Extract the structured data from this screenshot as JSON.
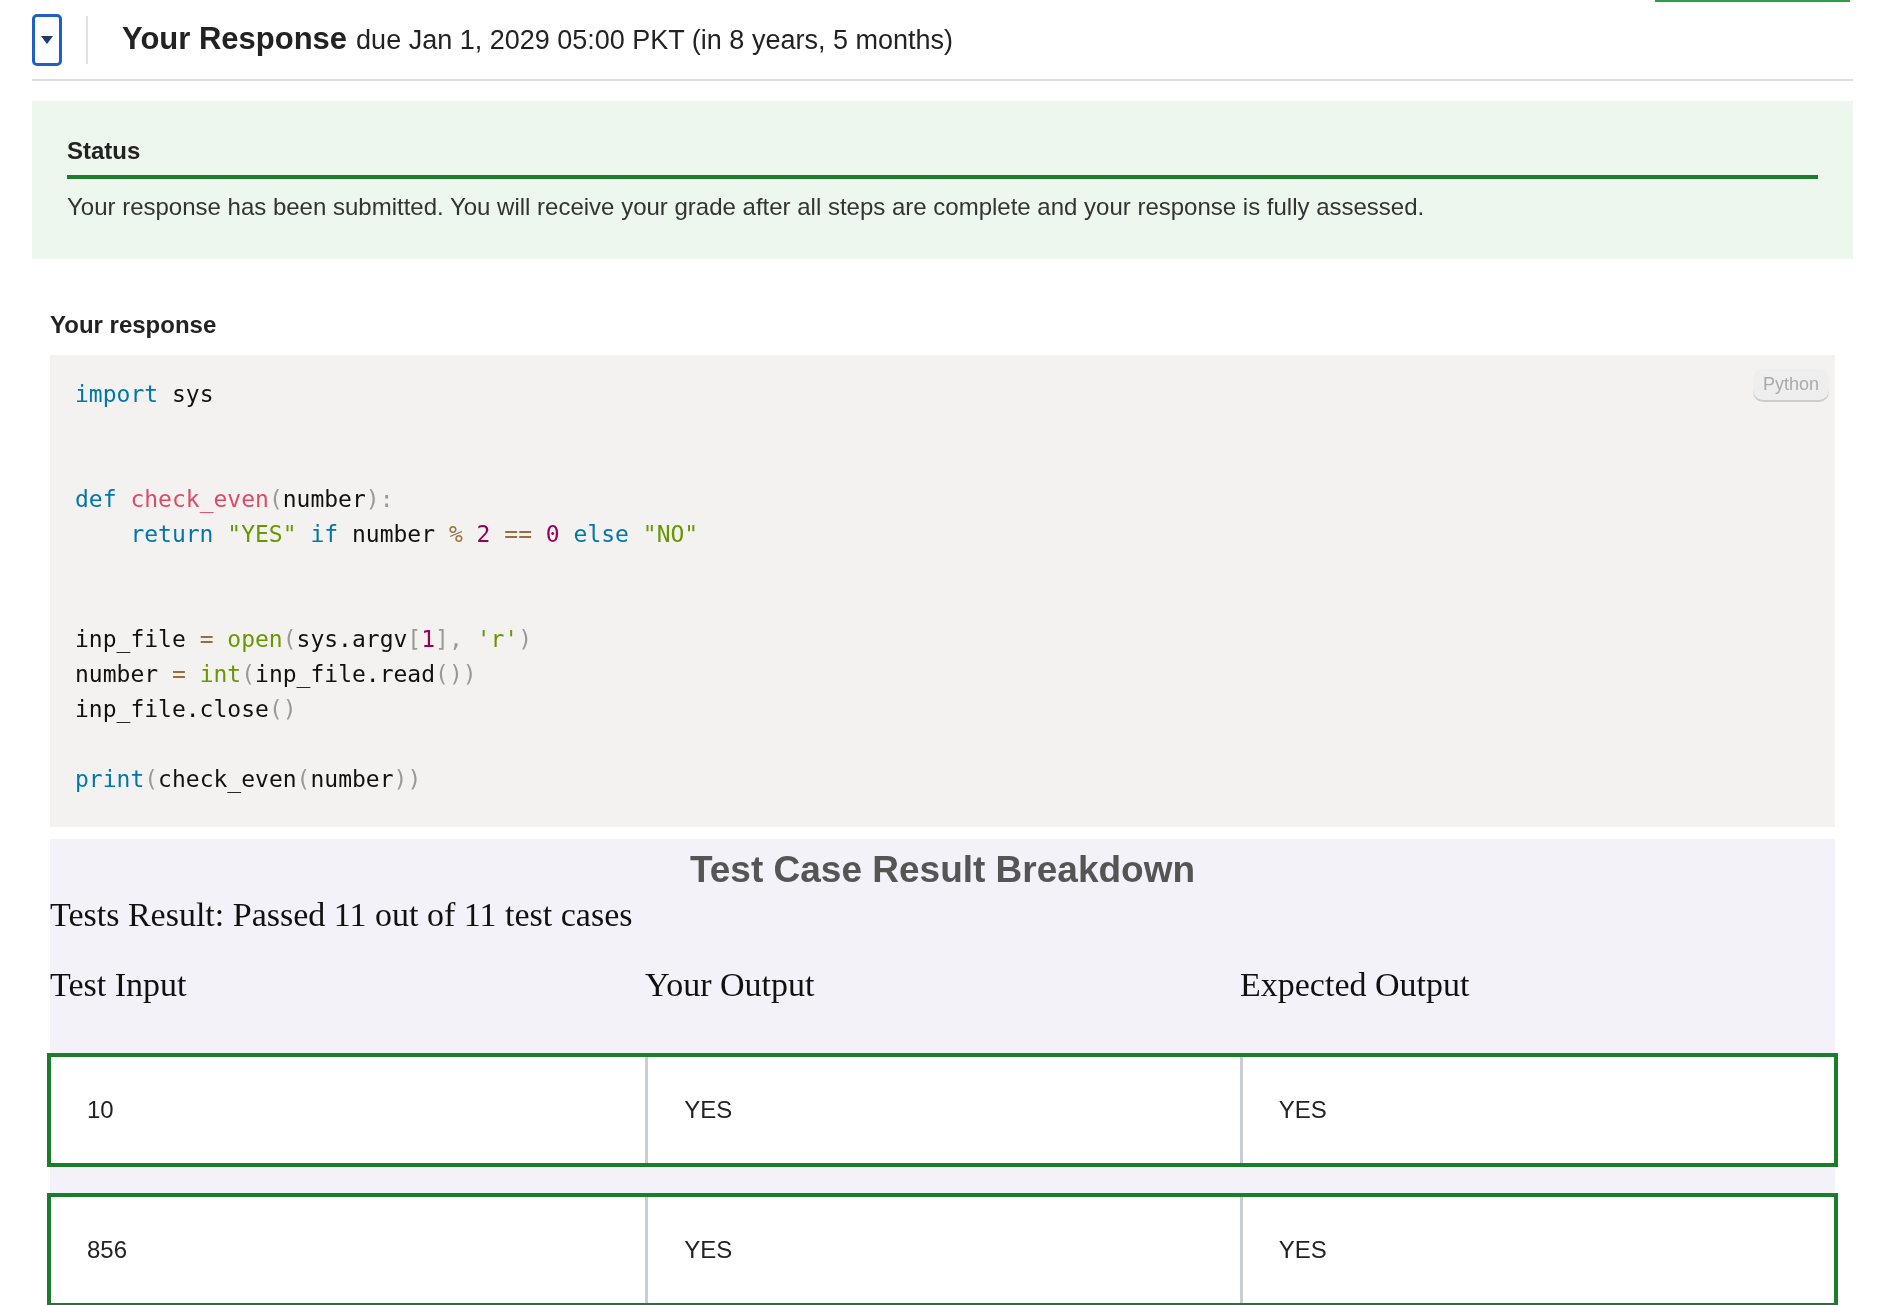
{
  "header": {
    "title": "Your Response",
    "due": "due Jan 1, 2029 05:00 PKT (in 8 years, 5 months)",
    "expanded": true
  },
  "status": {
    "heading": "Status",
    "message": "Your response has been submitted. You will receive your grade after all steps are complete and your response is fully assessed."
  },
  "response": {
    "label": "Your response",
    "language": "Python",
    "code_lines": [
      {
        "kind": "code",
        "tokens": [
          {
            "kind": "keyword",
            "text": "import"
          },
          {
            "kind": "plain",
            "text": " sys"
          }
        ]
      },
      {
        "kind": "blank"
      },
      {
        "kind": "blank"
      },
      {
        "kind": "code",
        "tokens": [
          {
            "kind": "keyword",
            "text": "def "
          },
          {
            "kind": "function",
            "text": "check_even"
          },
          {
            "kind": "punct",
            "text": "("
          },
          {
            "kind": "plain",
            "text": "number"
          },
          {
            "kind": "punct",
            "text": "):"
          }
        ]
      },
      {
        "kind": "code",
        "tokens": [
          {
            "kind": "keyword",
            "text": "    return "
          },
          {
            "kind": "string",
            "text": "\"YES\" "
          },
          {
            "kind": "keyword",
            "text": "if"
          },
          {
            "kind": "plain",
            "text": " number "
          },
          {
            "kind": "operator",
            "text": "%"
          },
          {
            "kind": "number",
            "text": " 2 "
          },
          {
            "kind": "operator",
            "text": "=="
          },
          {
            "kind": "number",
            "text": " 0 "
          },
          {
            "kind": "keyword",
            "text": "else "
          },
          {
            "kind": "string",
            "text": "\"NO\""
          }
        ]
      },
      {
        "kind": "blank"
      },
      {
        "kind": "blank"
      },
      {
        "kind": "code",
        "tokens": [
          {
            "kind": "plain",
            "text": "inp_file "
          },
          {
            "kind": "operator",
            "text": "= "
          },
          {
            "kind": "builtin",
            "text": "open"
          },
          {
            "kind": "punct",
            "text": "("
          },
          {
            "kind": "plain",
            "text": "sys.argv"
          },
          {
            "kind": "punct",
            "text": "["
          },
          {
            "kind": "number",
            "text": "1"
          },
          {
            "kind": "punct",
            "text": "], "
          },
          {
            "kind": "string",
            "text": "'r'"
          },
          {
            "kind": "punct",
            "text": ")"
          }
        ]
      },
      {
        "kind": "code",
        "tokens": [
          {
            "kind": "plain",
            "text": "number "
          },
          {
            "kind": "operator",
            "text": "= "
          },
          {
            "kind": "builtin",
            "text": "int"
          },
          {
            "kind": "punct",
            "text": "("
          },
          {
            "kind": "plain",
            "text": "inp_file.read"
          },
          {
            "kind": "punct",
            "text": "())"
          }
        ]
      },
      {
        "kind": "code",
        "tokens": [
          {
            "kind": "plain",
            "text": "inp_file.close"
          },
          {
            "kind": "punct",
            "text": "()"
          }
        ]
      },
      {
        "kind": "blank"
      },
      {
        "kind": "code",
        "tokens": [
          {
            "kind": "keyword",
            "text": "print"
          },
          {
            "kind": "punct",
            "text": "("
          },
          {
            "kind": "plain",
            "text": "check_even"
          },
          {
            "kind": "punct",
            "text": "("
          },
          {
            "kind": "plain",
            "text": "number"
          },
          {
            "kind": "punct",
            "text": "))"
          }
        ]
      }
    ]
  },
  "tests": {
    "title": "Test Case Result Breakdown",
    "summary": "Tests Result: Passed 11 out of 11 test cases",
    "columns": [
      "Test Input",
      "Your Output",
      "Expected Output"
    ],
    "rows": [
      {
        "passed": true,
        "cells": [
          "10",
          "YES",
          "YES"
        ]
      },
      {
        "passed": true,
        "cells": [
          "856",
          "YES",
          "YES"
        ]
      }
    ]
  }
}
